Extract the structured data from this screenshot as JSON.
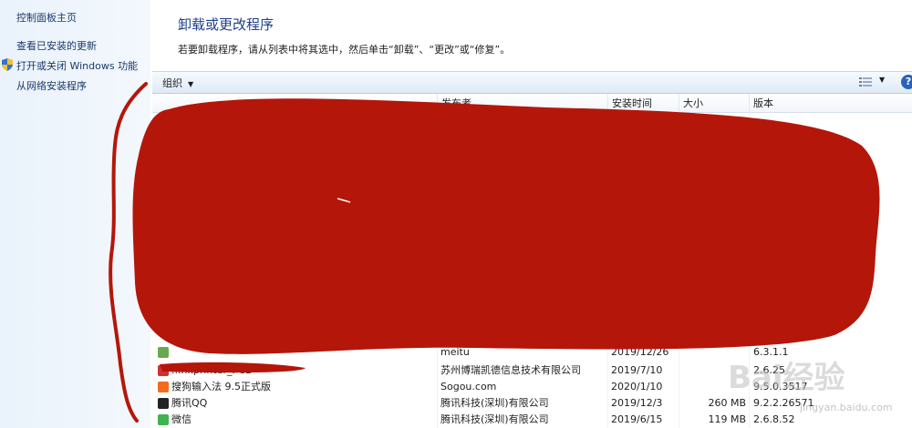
{
  "sidebar": {
    "home": "控制面板主页",
    "updates": "查看已安装的更新",
    "features": "打开或关闭 Windows 功能",
    "network": "从网络安装程序"
  },
  "header": {
    "title": "卸载或更改程序",
    "subtitle": "若要卸载程序，请从列表中将其选中，然后单击“卸载”、“更改”或“修复”。"
  },
  "toolbar": {
    "organize": "组织",
    "help": "?"
  },
  "table": {
    "columns": {
      "publisher": "发布者",
      "date": "安装时间",
      "size": "大小",
      "version": "版本"
    },
    "rows": [
      {
        "name": "",
        "publisher": "meitu",
        "date": "2019/12/26",
        "size": "",
        "version": "6.3.1.1",
        "icon_color": "#6aa84f"
      },
      {
        "name": "...nkprinter_PCL",
        "publisher": "苏州博瑞凯德信息技术有限公司",
        "date": "2019/7/10",
        "size": "",
        "version": "2.6.25",
        "icon_color": "#cc3333"
      },
      {
        "name": "搜狗输入法 9.5正式版",
        "publisher": "Sogou.com",
        "date": "2020/1/10",
        "size": "",
        "version": "9.5.0.3517",
        "icon_color": "#f26b21"
      },
      {
        "name": "腾讯QQ",
        "publisher": "腾讯科技(深圳)有限公司",
        "date": "2019/12/3",
        "size": "260 MB",
        "version": "9.2.2.26571",
        "icon_color": "#222222"
      },
      {
        "name": "微信",
        "publisher": "腾讯科技(深圳)有限公司",
        "date": "2019/6/15",
        "size": "119 MB",
        "version": "2.6.8.52",
        "icon_color": "#3fb34f"
      }
    ]
  },
  "watermark": {
    "text": "Bai经验",
    "sub": "jingyan.baidu.com"
  },
  "colors": {
    "redaction": "#b5160a",
    "title": "#1e3f8a",
    "link": "#1a3a6b"
  }
}
